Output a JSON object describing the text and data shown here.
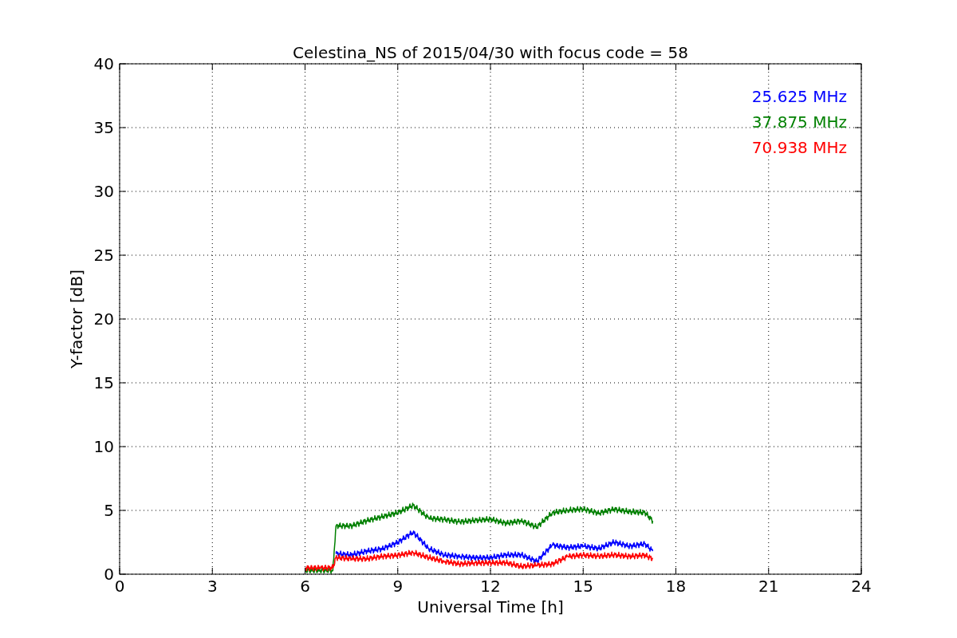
{
  "chart_data": {
    "type": "line",
    "title": "Celestina_NS of 2015/04/30 with focus code = 58",
    "xlabel": "Universal Time [h]",
    "ylabel": "Y-factor [dB]",
    "x": [
      6,
      6.5,
      6.9,
      7.0,
      7.5,
      8,
      8.5,
      9,
      9.5,
      10,
      10.5,
      11,
      11.5,
      12,
      12.5,
      13,
      13.5,
      14,
      14.5,
      15,
      15.5,
      16,
      16.5,
      17,
      17.25
    ],
    "series": [
      {
        "name": "25.625 MHz",
        "color": "#0000ff",
        "values": [
          null,
          null,
          null,
          1.6,
          1.5,
          1.8,
          2.0,
          2.5,
          3.3,
          2.0,
          1.5,
          1.4,
          1.3,
          1.3,
          1.5,
          1.5,
          1.0,
          2.3,
          2.1,
          2.2,
          2.0,
          2.5,
          2.2,
          2.4,
          1.8
        ]
      },
      {
        "name": "37.875 MHz",
        "color": "#008000",
        "values": [
          0.3,
          0.3,
          0.3,
          3.8,
          3.8,
          4.2,
          4.5,
          4.8,
          5.4,
          4.4,
          4.3,
          4.1,
          4.2,
          4.3,
          4.0,
          4.2,
          3.7,
          4.8,
          5.0,
          5.1,
          4.8,
          5.1,
          4.9,
          4.8,
          4.2
        ]
      },
      {
        "name": "70.938 MHz",
        "color": "#ff0000",
        "values": [
          0.5,
          0.5,
          0.5,
          1.3,
          1.2,
          1.2,
          1.4,
          1.5,
          1.7,
          1.3,
          1.0,
          0.8,
          0.9,
          0.9,
          0.9,
          0.6,
          0.7,
          0.8,
          1.4,
          1.5,
          1.4,
          1.5,
          1.4,
          1.5,
          1.2
        ]
      }
    ],
    "grid": true,
    "xlim": [
      0,
      24
    ],
    "ylim": [
      0,
      40
    ],
    "xticks": [
      0,
      3,
      6,
      9,
      12,
      15,
      18,
      21,
      24
    ],
    "yticks": [
      0,
      5,
      10,
      15,
      20,
      25,
      30,
      35,
      40
    ]
  }
}
